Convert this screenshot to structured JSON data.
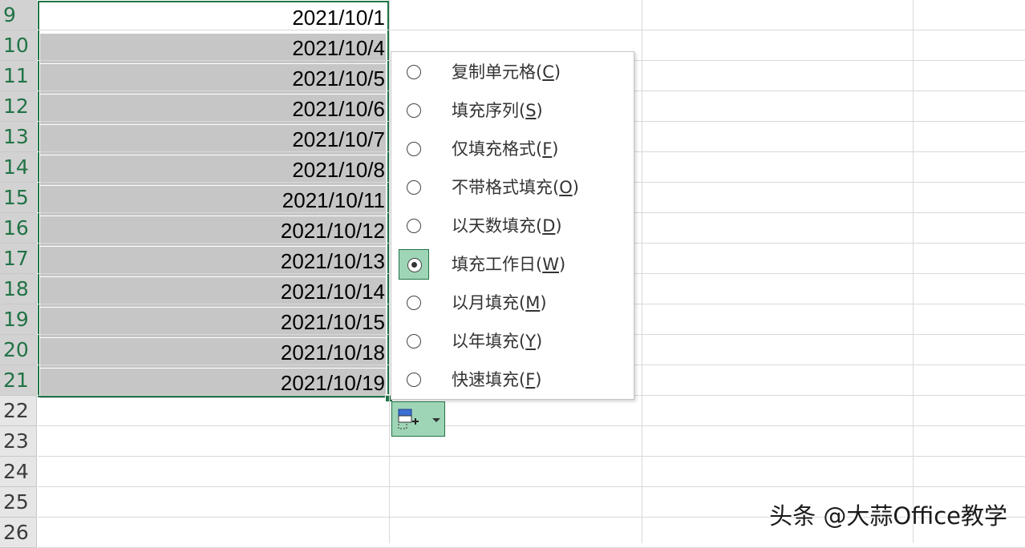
{
  "sheet": {
    "row_numbers": [
      "9",
      "10",
      "11",
      "12",
      "13",
      "14",
      "15",
      "16",
      "17",
      "18",
      "19",
      "20",
      "21",
      "22",
      "23",
      "24",
      "25",
      "26"
    ],
    "cells": [
      "2021/10/1",
      "2021/10/4",
      "2021/10/5",
      "2021/10/6",
      "2021/10/7",
      "2021/10/8",
      "2021/10/11",
      "2021/10/12",
      "2021/10/13",
      "2021/10/14",
      "2021/10/15",
      "2021/10/18",
      "2021/10/19"
    ]
  },
  "autofill_menu": {
    "items": [
      {
        "label": "复制单元格(",
        "key": "C",
        "close": ")",
        "checked": false
      },
      {
        "label": "填充序列(",
        "key": "S",
        "close": ")",
        "checked": false
      },
      {
        "label": "仅填充格式(",
        "key": "F",
        "close": ")",
        "checked": false
      },
      {
        "label": "不带格式填充(",
        "key": "O",
        "close": ")",
        "checked": false
      },
      {
        "label": "以天数填充(",
        "key": "D",
        "close": ")",
        "checked": false
      },
      {
        "label": "填充工作日(",
        "key": "W",
        "close": ")",
        "checked": true
      },
      {
        "label": "以月填充(",
        "key": "M",
        "close": ")",
        "checked": false
      },
      {
        "label": "以年填充(",
        "key": "Y",
        "close": ")",
        "checked": false
      },
      {
        "label": "快速填充(",
        "key": "F",
        "close": ")",
        "checked": false
      }
    ]
  },
  "autofill_button": {
    "icon": "autofill-options-icon"
  },
  "watermark": "头条 @大蒜Office教学",
  "colors": {
    "accent": "#217346",
    "selection_fill": "#c6c6c6",
    "checked_fill": "#9fd5b7"
  }
}
